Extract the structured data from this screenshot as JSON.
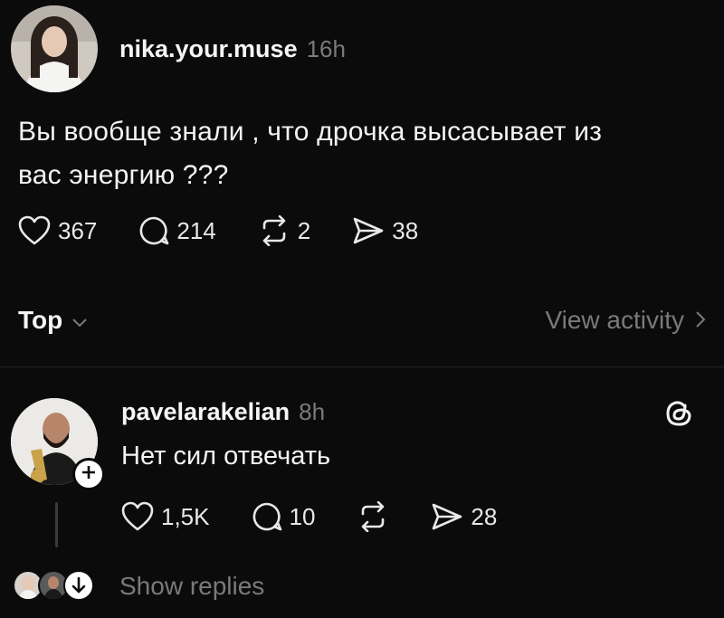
{
  "post": {
    "author": "nika.your.muse",
    "time": "16h",
    "text_line1": "Вы вообще знали , что дрочка высасывает из",
    "text_line2": "вас энергию ???",
    "likes": "367",
    "comments": "214",
    "reposts": "2",
    "shares": "38"
  },
  "replies_header": {
    "sort_label": "Top",
    "view_activity_label": "View activity"
  },
  "reply": {
    "author": "pavelarakelian",
    "time": "8h",
    "text": "Нет сил отвечать",
    "likes": "1,5K",
    "comments": "10",
    "shares": "28"
  },
  "show_replies_label": "Show replies",
  "icons": {
    "like": "heart-icon",
    "comment": "comment-icon",
    "repost": "repost-icon",
    "share": "share-icon",
    "threads": "threads-logo-icon"
  },
  "colors": {
    "background": "#0b0b0b",
    "text": "#f3f3f3",
    "muted": "#7a7a7a"
  }
}
